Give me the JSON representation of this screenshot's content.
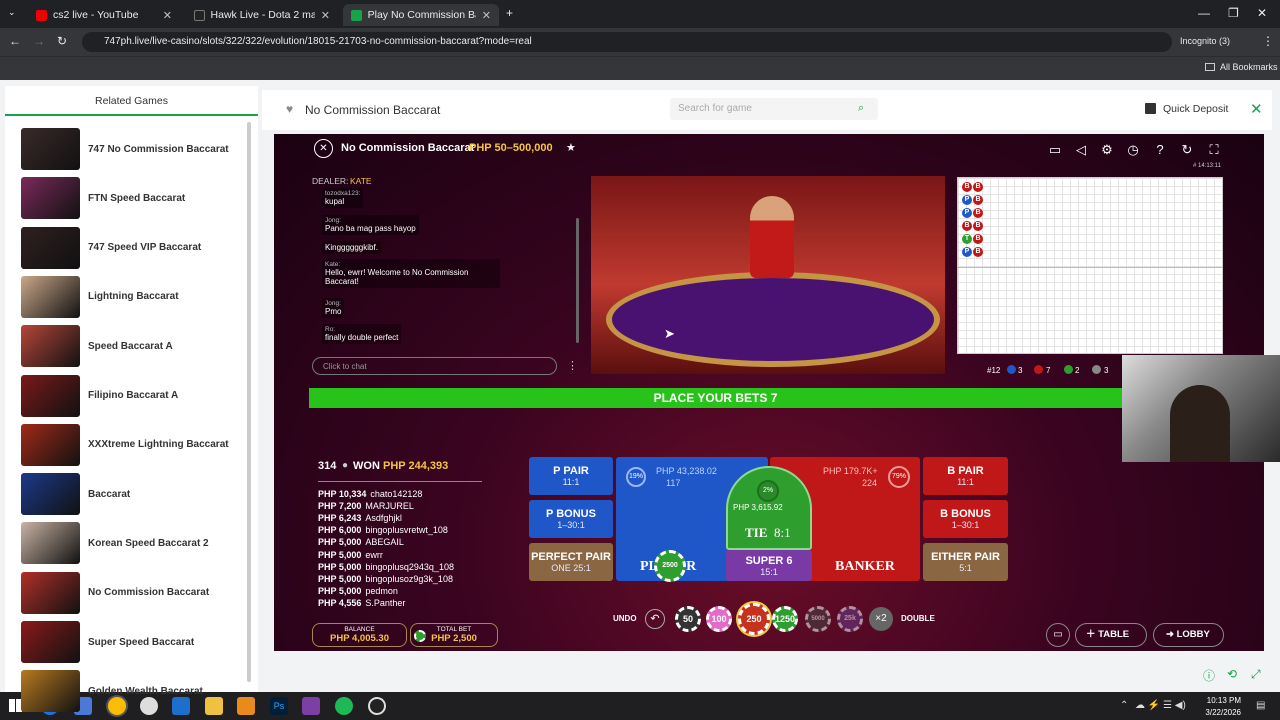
{
  "browser": {
    "tabs": [
      {
        "title": "cs2 live - YouTube"
      },
      {
        "title": "Hawk Live - Dota 2 matches live"
      },
      {
        "title": "Play No Commission Baccarat"
      }
    ],
    "new_tab": "+",
    "url": "747ph.live/live-casino/slots/322/322/evolution/18015-21703-no-commission-baccarat?mode=real",
    "profile": "Incognito (3)",
    "all_bookmarks": "All Bookmarks"
  },
  "site": {
    "related_title": "Related Games",
    "related_games": [
      {
        "name": "747 No Commission Baccarat",
        "color": "#3a2a2a"
      },
      {
        "name": "FTN Speed Baccarat",
        "color": "#7a2a5a"
      },
      {
        "name": "747 Speed VIP Baccarat",
        "color": "#2f2020"
      },
      {
        "name": "Lightning Baccarat",
        "color": "#caa88a"
      },
      {
        "name": "Speed Baccarat A",
        "color": "#b5463a"
      },
      {
        "name": "Filipino Baccarat A",
        "color": "#7a1a1a"
      },
      {
        "name": "XXXtreme Lightning Baccarat",
        "color": "#a02a18"
      },
      {
        "name": "Baccarat",
        "color": "#1c3a8a"
      },
      {
        "name": "Korean Speed Baccarat 2",
        "color": "#c9b3a4"
      },
      {
        "name": "No Commission Baccarat",
        "color": "#b0302a"
      },
      {
        "name": "Super Speed Baccarat",
        "color": "#8a1a1a"
      },
      {
        "name": "Golden Wealth Baccarat",
        "color": "#b87a20"
      }
    ],
    "game_title": "No Commission Baccarat",
    "search_placeholder": "Search for game",
    "quick_deposit": "Quick Deposit"
  },
  "game": {
    "title": "No Commission Baccarat",
    "limits": "PHP 50–500,000",
    "time": "# 14:13:11",
    "dealer_label": "DEALER:",
    "dealer_name": "KATE",
    "chat": [
      {
        "user": "tozodxa123:",
        "text": "kupal"
      },
      {
        "user": "Jong:",
        "text": "Pano ba mag pass hayop"
      },
      {
        "user": "",
        "text": "Kinggggggkibf."
      },
      {
        "user": "Kate:",
        "text": "Hello, ewrr! Welcome to No Commission Baccarat!"
      },
      {
        "user": "Jong:",
        "text": "Pmo"
      },
      {
        "user": "Ro:",
        "text": "finally double perfect"
      }
    ],
    "chat_placeholder": "Click to chat",
    "stats": {
      "total": "#12",
      "player": "3",
      "banker": "7",
      "tie": "2",
      "other": "3"
    },
    "place_bets": "PLACE YOUR BETS 7",
    "players_count": "314",
    "won_label": "WON",
    "won_amount": "PHP 244,393",
    "winners": [
      {
        "amount": "PHP 10,334",
        "name": "chato142128"
      },
      {
        "amount": "PHP 7,200",
        "name": "MARJUREL"
      },
      {
        "amount": "PHP 6,243",
        "name": "Asdfghjkl"
      },
      {
        "amount": "PHP 6,000",
        "name": "bingoplusvretwt_108"
      },
      {
        "amount": "PHP 5,000",
        "name": "ABEGAIL"
      },
      {
        "amount": "PHP 5,000",
        "name": "ewrr"
      },
      {
        "amount": "PHP 5,000",
        "name": "bingoplusq2943q_108"
      },
      {
        "amount": "PHP 5,000",
        "name": "bingoplusoz9g3k_108"
      },
      {
        "amount": "PHP 5,000",
        "name": "pedmon"
      },
      {
        "amount": "PHP 4,556",
        "name": "S.Panther"
      }
    ],
    "balance_label": "BALANCE",
    "balance": "PHP 4,005.30",
    "total_bet_label": "TOTAL BET",
    "total_bet": "PHP 2,500",
    "bets": {
      "p_pair": "P PAIR",
      "p_pair_odds": "11:1",
      "p_bonus": "P BONUS",
      "p_bonus_odds": "1–30:1",
      "perfect_pair": "PERFECT PAIR",
      "perfect_pair_odds": "ONE 25:1",
      "player_amount": "PHP 43,238.02",
      "player_count": "117",
      "player_pct": "19%",
      "player": "PLAYER",
      "tie": "TIE",
      "tie_odds": "8:1",
      "tie_pct": "2%",
      "tie_amount": "PHP 3,615.92",
      "super6": "SUPER 6",
      "super6_odds": "15:1",
      "banker_amount": "PHP 179.7K+",
      "banker_count": "224",
      "banker_pct": "79%",
      "banker": "BANKER",
      "b_pair": "B PAIR",
      "b_pair_odds": "11:1",
      "b_bonus": "B BONUS",
      "b_bonus_odds": "1–30:1",
      "either_pair": "EITHER PAIR",
      "either_pair_odds": "5:1",
      "placed_chip": "2500"
    },
    "undo": "UNDO",
    "chips": [
      "50",
      "100",
      "250",
      "1250",
      "5000",
      "25k"
    ],
    "double_mult": "×2",
    "double": "DOUBLE",
    "table_btn": "TABLE",
    "lobby_btn": "LOBBY"
  },
  "taskbar": {
    "time": "10:13 PM",
    "date": "3/22/2026"
  },
  "colors": {
    "player": "#1f57c8",
    "banker": "#c01818",
    "tie": "#2e9e2e",
    "accent": "#16a34a"
  }
}
